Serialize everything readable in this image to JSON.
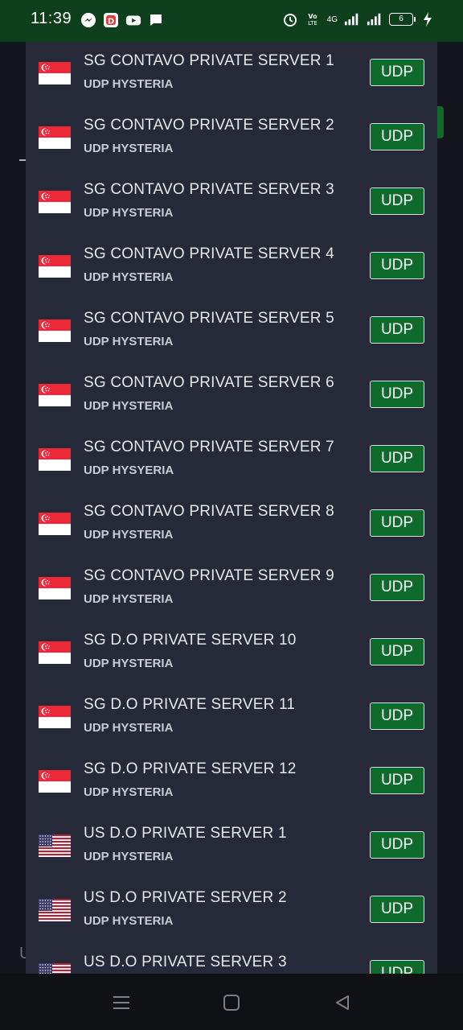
{
  "status_bar": {
    "time": "11:39",
    "battery_level": "6",
    "network": "4G",
    "icons": [
      "messenger-icon",
      "app-d-icon",
      "youtube-icon",
      "message-icon",
      "alarm-icon",
      "volte-icon",
      "signal-icon",
      "battery-icon",
      "charging-icon"
    ]
  },
  "servers": [
    {
      "flag": "sg",
      "name": "SG CONTAVO PRIVATE SERVER 1",
      "protocol": "UDP HYSTERIA",
      "button": "UDP"
    },
    {
      "flag": "sg",
      "name": "SG CONTAVO PRIVATE SERVER 2",
      "protocol": "UDP HYSTERIA",
      "button": "UDP"
    },
    {
      "flag": "sg",
      "name": "SG CONTAVO PRIVATE SERVER 3",
      "protocol": "UDP HYSTERIA",
      "button": "UDP"
    },
    {
      "flag": "sg",
      "name": "SG CONTAVO PRIVATE SERVER 4",
      "protocol": "UDP HYSTERIA",
      "button": "UDP"
    },
    {
      "flag": "sg",
      "name": "SG CONTAVO PRIVATE SERVER 5",
      "protocol": "UDP HYSTERIA",
      "button": "UDP"
    },
    {
      "flag": "sg",
      "name": "SG CONTAVO PRIVATE SERVER 6",
      "protocol": "UDP HYSTERIA",
      "button": "UDP"
    },
    {
      "flag": "sg",
      "name": "SG CONTAVO PRIVATE SERVER 7",
      "protocol": "UDP HYSYERIA",
      "button": "UDP"
    },
    {
      "flag": "sg",
      "name": "SG CONTAVO PRIVATE SERVER 8",
      "protocol": "UDP HYSTERIA",
      "button": "UDP"
    },
    {
      "flag": "sg",
      "name": "SG CONTAVO PRIVATE SERVER 9",
      "protocol": "UDP HYSTERIA",
      "button": "UDP"
    },
    {
      "flag": "sg",
      "name": "SG D.O PRIVATE SERVER 10",
      "protocol": "UDP HYSTERIA",
      "button": "UDP"
    },
    {
      "flag": "sg",
      "name": "SG D.O PRIVATE SERVER 11",
      "protocol": "UDP HYSTERIA",
      "button": "UDP"
    },
    {
      "flag": "sg",
      "name": "SG D.O PRIVATE SERVER 12",
      "protocol": "UDP HYSTERIA",
      "button": "UDP"
    },
    {
      "flag": "us",
      "name": "US D.O PRIVATE SERVER 1",
      "protocol": "UDP HYSTERIA",
      "button": "UDP"
    },
    {
      "flag": "us",
      "name": "US D.O PRIVATE SERVER 2",
      "protocol": "UDP HYSTERIA",
      "button": "UDP"
    },
    {
      "flag": "us",
      "name": "US D.O PRIVATE SERVER 3",
      "protocol": "UDP HYSTERIA",
      "button": "UDP"
    }
  ],
  "background": {
    "partial_letter": "U"
  },
  "nav_bar": {
    "icons": [
      "menu-icon",
      "home-icon",
      "back-icon"
    ]
  },
  "colors": {
    "status_bar": "#0d3f1d",
    "dialog": "#262938",
    "button": "#0f6b2c"
  }
}
